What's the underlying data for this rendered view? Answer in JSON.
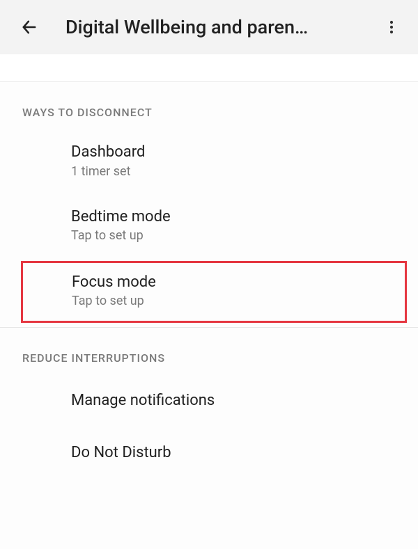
{
  "header": {
    "title": "Digital Wellbeing and paren…"
  },
  "sections": {
    "disconnect": {
      "header": "WAYS TO DISCONNECT",
      "items": {
        "dashboard": {
          "title": "Dashboard",
          "subtitle": "1 timer set"
        },
        "bedtime": {
          "title": "Bedtime mode",
          "subtitle": "Tap to set up"
        },
        "focus": {
          "title": "Focus mode",
          "subtitle": "Tap to set up"
        }
      }
    },
    "reduce": {
      "header": "REDUCE INTERRUPTIONS",
      "items": {
        "manage_notifications": {
          "title": "Manage notifications"
        },
        "dnd": {
          "title": "Do Not Disturb"
        }
      }
    }
  }
}
